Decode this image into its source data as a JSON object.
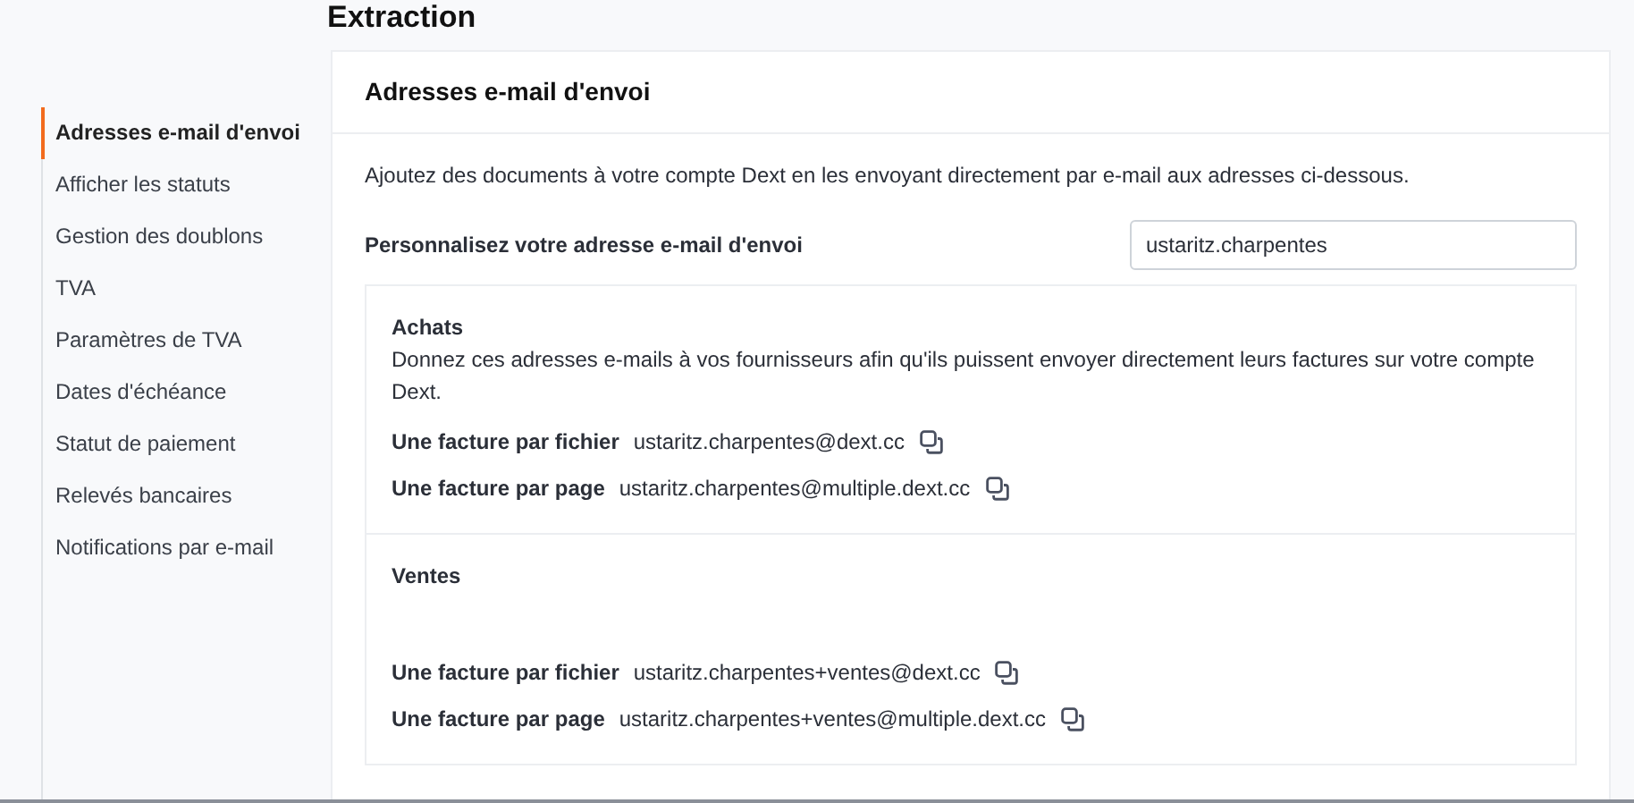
{
  "page_title": "Extraction",
  "sidebar": {
    "items": [
      {
        "label": "Adresses e-mail d'envoi",
        "selected": true
      },
      {
        "label": "Afficher les statuts",
        "selected": false
      },
      {
        "label": "Gestion des doublons",
        "selected": false
      },
      {
        "label": "TVA",
        "selected": false
      },
      {
        "label": "Paramètres de TVA",
        "selected": false
      },
      {
        "label": "Dates d'échéance",
        "selected": false
      },
      {
        "label": "Statut de paiement",
        "selected": false
      },
      {
        "label": "Relevés bancaires",
        "selected": false
      },
      {
        "label": "Notifications par e-mail",
        "selected": false
      }
    ]
  },
  "card": {
    "title": "Adresses e-mail d'envoi",
    "intro": "Ajoutez des documents à votre compte Dext en les envoyant directement par e-mail aux adresses ci-dessous.",
    "custom_address": {
      "label": "Personnalisez votre adresse e-mail d'envoi",
      "value": "ustaritz.charpentes"
    },
    "sections": [
      {
        "title": "Achats",
        "description": "Donnez ces adresses e-mails à vos fournisseurs afin qu'ils puissent envoyer directement leurs factures sur votre compte Dext.",
        "addresses": [
          {
            "label": "Une facture par fichier",
            "email": "ustaritz.charpentes@dext.cc"
          },
          {
            "label": "Une facture par page",
            "email": "ustaritz.charpentes@multiple.dext.cc"
          }
        ]
      },
      {
        "title": "Ventes",
        "addresses": [
          {
            "label": "Une facture par fichier",
            "email": "ustaritz.charpentes+ventes@dext.cc"
          },
          {
            "label": "Une facture par page",
            "email": "ustaritz.charpentes+ventes@multiple.dext.cc"
          }
        ]
      }
    ]
  }
}
